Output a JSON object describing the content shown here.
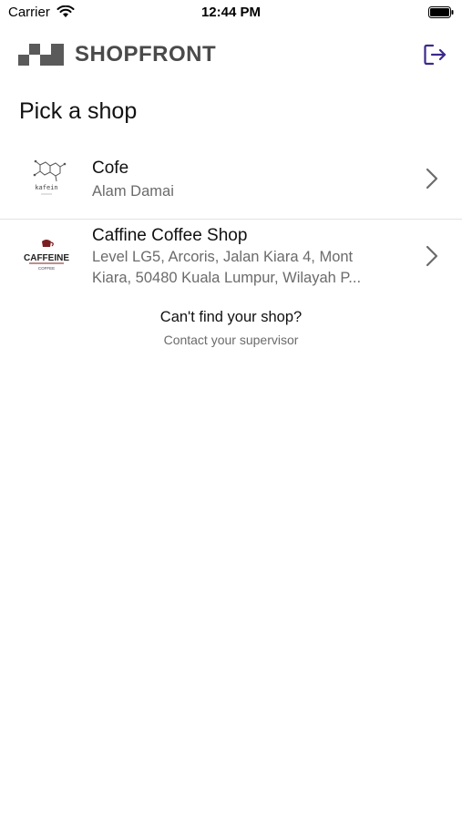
{
  "status_bar": {
    "carrier": "Carrier",
    "time": "12:44 PM",
    "icons": [
      "wifi-icon",
      "battery-icon"
    ]
  },
  "header": {
    "app_name": "SHOPFRONT",
    "logo_icon": "checker-logo-icon",
    "logout_icon": "logout-icon",
    "accent_color": "#3b2a8c"
  },
  "page": {
    "title": "Pick a shop"
  },
  "shops": [
    {
      "name": "Cofe",
      "address": "Alam Damai",
      "logo_text": "kafein",
      "logo_icon": "molecule-logo-icon"
    },
    {
      "name": "Caffine Coffee Shop",
      "address_line1": "Level LG5, Arcoris, Jalan Kiara 4, Mont",
      "address_line2": "Kiara, 50480 Kuala Lumpur, Wilayah P...",
      "logo_text": "CAFFEINE",
      "logo_subtext": "COFFEE",
      "logo_icon": "cup-logo-icon"
    }
  ],
  "help": {
    "title": "Can't find your shop?",
    "subtitle": "Contact your supervisor"
  }
}
